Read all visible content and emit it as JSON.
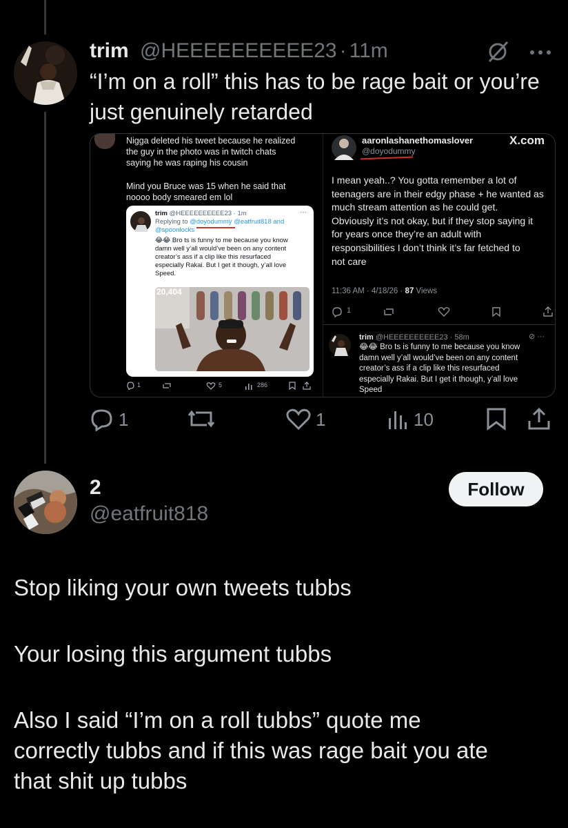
{
  "thread": {
    "tweet": {
      "display_name": "trim",
      "handle": "@HEEEEEEEEEE23",
      "dot": "·",
      "time": "11m",
      "text_line1": "“I’m on a roll” this has to be rage bait or you’re",
      "text_line2": "just genuinely retarded",
      "actions": {
        "reply_count": "1",
        "retweet_count": "",
        "like_count": "1",
        "view_count": "10"
      }
    },
    "quote_image": {
      "left": {
        "lines": [
          "Nigga deleted his tweet because he realized",
          "the guy  in the photo was in twitch chats",
          "saying he was raping his cousin"
        ],
        "lines2": [
          "Mind you Bruce was 15 when he said that",
          "noooo body smeared em lol"
        ],
        "card": {
          "name": "trim",
          "handle_time": "@HEEEEEEEEEE23 · 1m",
          "replying_prefix": "Replying to ",
          "replying_users": "@doyodummy @eatfruit818 and",
          "replying_users2": "@spoonlocks",
          "text_lines": [
            "😂😂 Bro ts is funny to me because you know",
            "damn well y’all would’ve been on any content",
            "creator’s ass if a clip like this resurfaced",
            "especially Rakai. But I get it though, y’all love",
            "Speed."
          ],
          "image_overlay": "20,404"
        },
        "stats": {
          "reply": "1",
          "like": "5",
          "views": "286"
        }
      },
      "right": {
        "name": "aaronlashanethomaslover",
        "handle": "@doyodummy",
        "brand": "X.com",
        "text_lines": [
          "I mean yeah..? You gotta remember a lot of",
          "teenagers are in their edgy phase + he wanted as",
          "much stream attention as he could get.",
          "Obviously it’s not okay, but if they stop saying it",
          "for years once they’re an adult with",
          "responsibilities I don’t think it’s far fetched to",
          "not care"
        ],
        "timestamp": "11:36 AM · 4/18/26 · ",
        "views_count": "87",
        "views_label": " Views",
        "reply_count": "1",
        "reply_card": {
          "name": "trim",
          "handle_time": "@HEEEEEEEEEE23 · 58m",
          "text_lines": [
            "😂😂 Bro ts is funny to me because you know",
            "damn well y’all would’ve been on any content",
            "creator’s ass if a clip like this resurfaced",
            "especially Rakai. But I get it though, y’all love",
            "Speed"
          ]
        }
      }
    }
  },
  "reply": {
    "display_name": "2",
    "handle": "@eatfruit818",
    "follow_label": "Follow",
    "paragraphs": [
      [
        "Stop liking your own tweets tubbs"
      ],
      [
        "Your losing this argument tubbs"
      ],
      [
        "Also I said “I’m on a roll tubbs” quote me",
        "correctly tubbs and if this was rage bait you ate",
        "that shit up tubbs"
      ]
    ]
  },
  "colors": {
    "accent": "#1d9bf0",
    "text": "#e7e9ea",
    "muted": "#71767b",
    "underline": "#d0312d"
  },
  "icons": [
    "reply-icon",
    "retweet-icon",
    "like-icon",
    "views-icon",
    "bookmark-icon",
    "share-icon",
    "grok-icon",
    "more-icon"
  ]
}
